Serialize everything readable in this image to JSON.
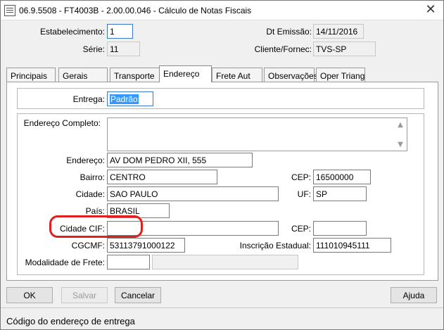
{
  "window": {
    "title": "06.9.5508 - FT4003B - 2.00.00.046 - Cálculo de Notas Fiscais",
    "close_glyph": "✕"
  },
  "header": {
    "estabelecimento_label": "Estabelecimento:",
    "estabelecimento_value": "1",
    "dt_emissao_label": "Dt Emissão:",
    "dt_emissao_value": "14/11/2016",
    "serie_label": "Série:",
    "serie_value": "11",
    "cliente_label": "Cliente/Fornec:",
    "cliente_value": "TVS-SP"
  },
  "tabs": [
    {
      "label": "Principais"
    },
    {
      "label": "Gerais"
    },
    {
      "label": "Transporte"
    },
    {
      "label": "Endereço",
      "active": true
    },
    {
      "label": "Frete Aut"
    },
    {
      "label": "Observações"
    },
    {
      "label": "Oper Triang"
    }
  ],
  "form": {
    "entrega_label": "Entrega:",
    "entrega_value": "Padrão",
    "endereco_completo_label": "Endereço Completo:",
    "endereco_completo_value": "",
    "endereco_label": "Endereço:",
    "endereco_value": "AV DOM PEDRO XII, 555",
    "bairro_label": "Bairro:",
    "bairro_value": "CENTRO",
    "cep_label": "CEP:",
    "cep_value": "16500000",
    "cidade_label": "Cidade:",
    "cidade_value": "SAO PAULO",
    "uf_label": "UF:",
    "uf_value": "SP",
    "pais_label": "País:",
    "pais_value": "BRASIL",
    "cidade_cif_label": "Cidade CIF:",
    "cidade_cif_value": "",
    "cep_cif_label": "CEP:",
    "cep_cif_value": "",
    "cgcmf_label": "CGCMF:",
    "cgcmf_value": "53113791000122",
    "inscricao_label": "Inscrição Estadual:",
    "inscricao_value": "111010945111",
    "modalidade_label": "Modalidade de Frete:",
    "modalidade_value": "",
    "modalidade_desc": ""
  },
  "buttons": {
    "ok": "OK",
    "salvar": "Salvar",
    "cancelar": "Cancelar",
    "ajuda": "Ajuda"
  },
  "status": {
    "text": "Código do endereço de entrega"
  },
  "colors": {
    "highlight": "#e0201c",
    "selection": "#3399ff"
  },
  "icons": {
    "scroll_up": "▲",
    "scroll_down": "▼"
  }
}
